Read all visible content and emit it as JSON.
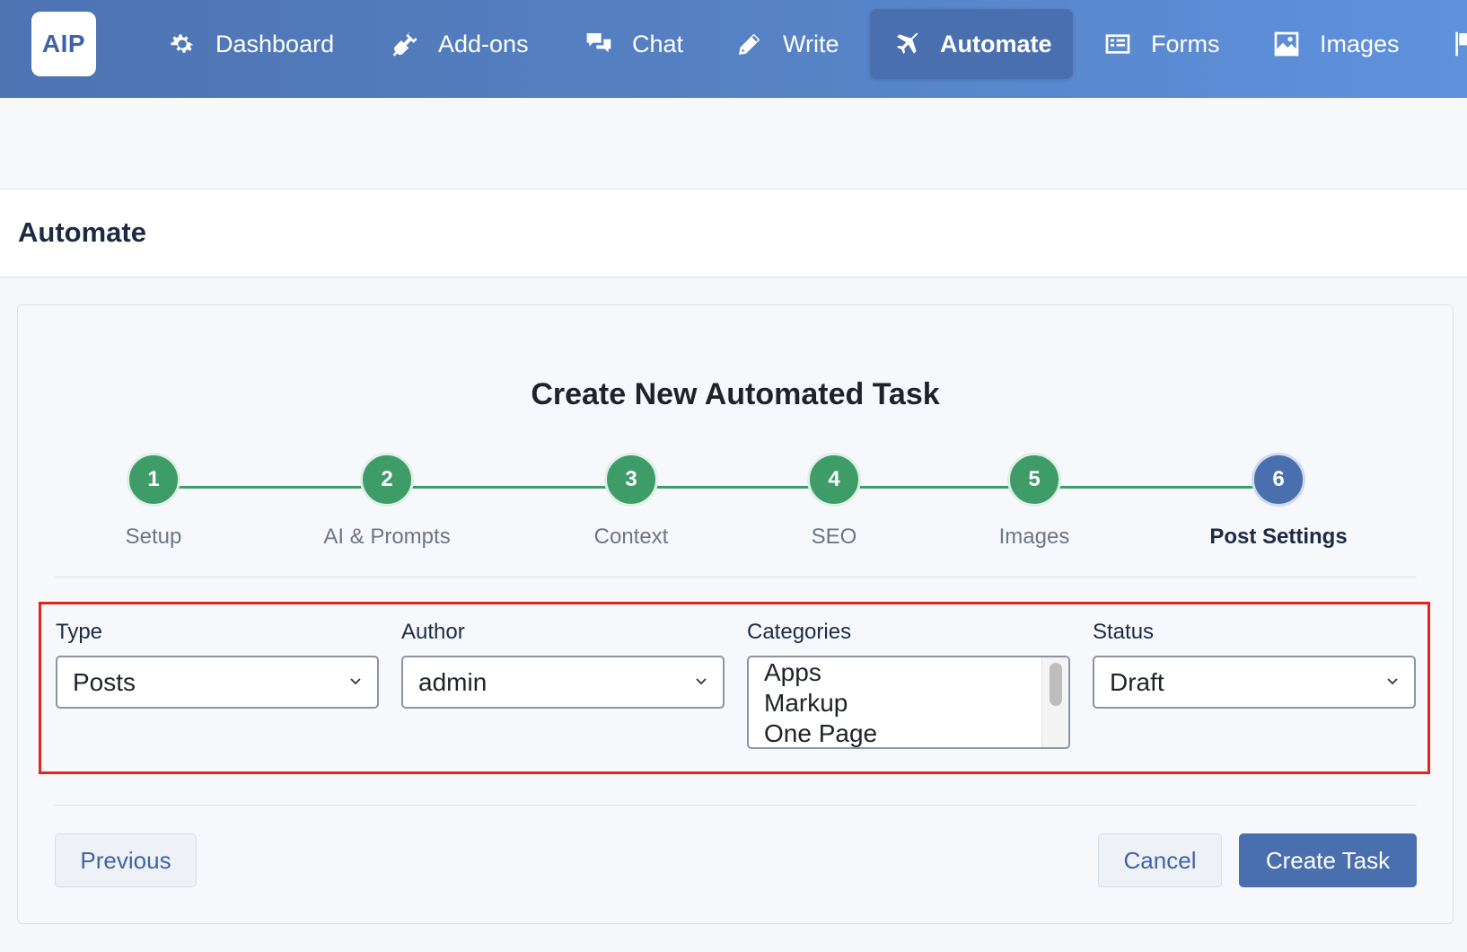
{
  "app": {
    "logo_text": "AIP"
  },
  "nav": {
    "items": [
      {
        "label": "Dashboard",
        "icon": "gear-icon"
      },
      {
        "label": "Add-ons",
        "icon": "plug-icon"
      },
      {
        "label": "Chat",
        "icon": "chat-bubbles-icon"
      },
      {
        "label": "Write",
        "icon": "pencil-icon"
      },
      {
        "label": "Automate",
        "icon": "plane-icon",
        "active": true
      },
      {
        "label": "Forms",
        "icon": "form-icon"
      },
      {
        "label": "Images",
        "icon": "image-icon"
      }
    ],
    "overflow_icon": "flag-icon"
  },
  "page": {
    "title": "Automate"
  },
  "wizard": {
    "title": "Create New Automated Task",
    "steps": [
      {
        "number": "1",
        "label": "Setup",
        "state": "complete"
      },
      {
        "number": "2",
        "label": "AI & Prompts",
        "state": "complete"
      },
      {
        "number": "3",
        "label": "Context",
        "state": "complete"
      },
      {
        "number": "4",
        "label": "SEO",
        "state": "complete"
      },
      {
        "number": "5",
        "label": "Images",
        "state": "complete"
      },
      {
        "number": "6",
        "label": "Post Settings",
        "state": "current"
      }
    ]
  },
  "form": {
    "type": {
      "label": "Type",
      "value": "Posts"
    },
    "author": {
      "label": "Author",
      "value": "admin"
    },
    "categories": {
      "label": "Categories",
      "options": [
        "Apps",
        "Markup",
        "One Page"
      ]
    },
    "status": {
      "label": "Status",
      "value": "Draft"
    }
  },
  "actions": {
    "previous": "Previous",
    "cancel": "Cancel",
    "create": "Create Task"
  },
  "colors": {
    "nav_gradient_start": "#4d73b1",
    "nav_gradient_end": "#5f91dd",
    "step_complete": "#3e9c68",
    "step_current": "#4a6fae",
    "highlight_border": "#e0261b",
    "primary_button": "#4a6fae"
  }
}
